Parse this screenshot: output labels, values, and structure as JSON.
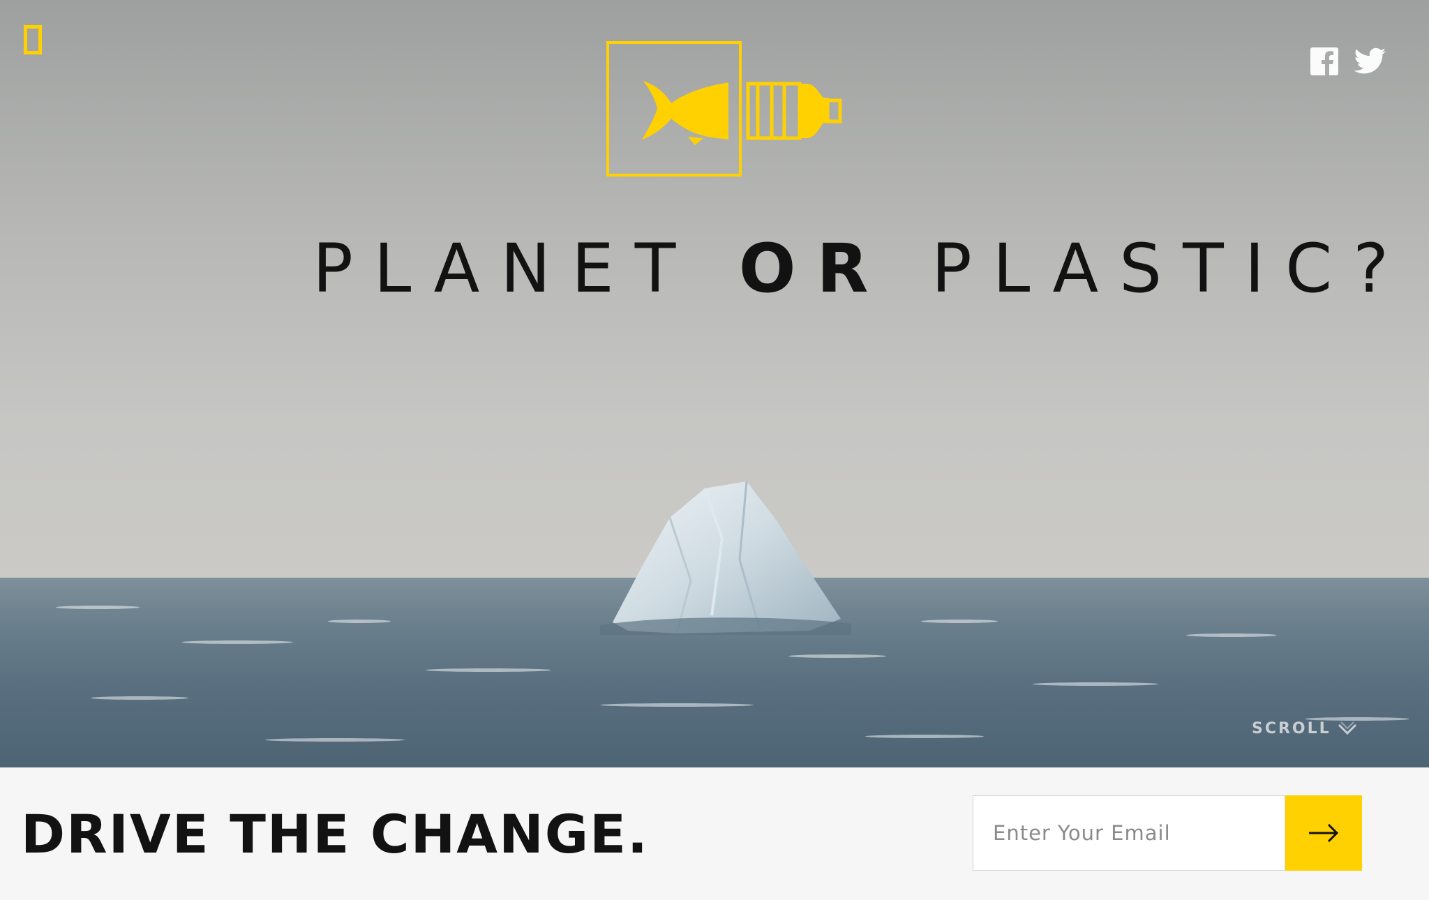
{
  "header": {
    "logo_icon": "national-geographic-yellow-rectangle-icon",
    "brand_mark_icon": "fish-bottle-icon",
    "social": [
      {
        "name": "facebook",
        "icon": "facebook-icon"
      },
      {
        "name": "twitter",
        "icon": "twitter-icon"
      }
    ]
  },
  "hero": {
    "headline_part1": "PLANET",
    "headline_or": "OR",
    "headline_part2": "PLASTIC?",
    "scroll_label": "SCROLL",
    "scroll_icon": "chevron-down-icon"
  },
  "signup": {
    "headline": "DRIVE THE CHANGE.",
    "email_placeholder": "Enter Your Email",
    "email_value": "",
    "submit_icon": "arrow-right-icon"
  },
  "colors": {
    "accent_yellow": "#ffd100",
    "text_dark": "#121212",
    "footer_bg": "#f6f6f6"
  }
}
